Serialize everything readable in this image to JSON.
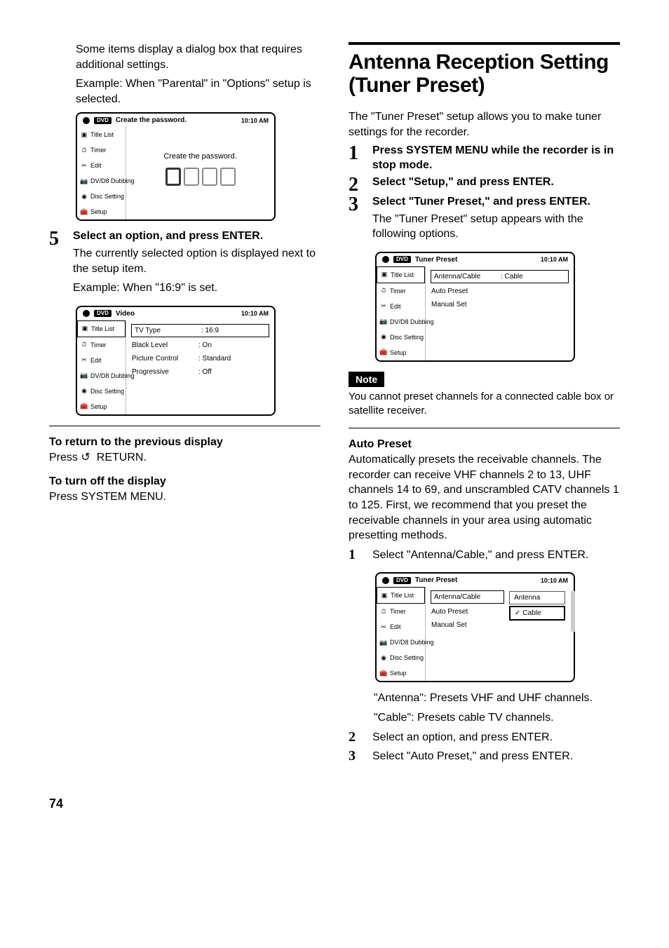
{
  "left": {
    "intro1": "Some items display a dialog box that requires additional settings.",
    "intro2": "Example: When \"Parental\" in \"Options\" setup is selected.",
    "screenshot1": {
      "badge": "DVD",
      "title": "Create the password.",
      "time": "10:10 AM",
      "sidebar": [
        "Title List",
        "Timer",
        "Edit",
        "DV/D8 Dubbing",
        "Disc Setting",
        "Setup"
      ],
      "prompt": "Create the password."
    },
    "step5": {
      "num": "5",
      "title": "Select an option, and press ENTER.",
      "desc1": "The currently selected option is displayed next to the setup item.",
      "desc2": "Example: When \"16:9\" is set."
    },
    "screenshot2": {
      "badge": "DVD",
      "title": "Video",
      "time": "10:10 AM",
      "sidebar": [
        "Title List",
        "Timer",
        "Edit",
        "DV/D8 Dubbing",
        "Disc Setting",
        "Setup"
      ],
      "rows": [
        {
          "label": "TV Type",
          "value": ": 16:9"
        },
        {
          "label": "Black Level",
          "value": ": On"
        },
        {
          "label": "Picture Control",
          "value": ": Standard"
        },
        {
          "label": "Progressive",
          "value": ": Off"
        }
      ]
    },
    "returnHeading": "To return to the previous display",
    "returnText": "Press ",
    "returnText2": " RETURN.",
    "offHeading": "To turn off the display",
    "offText": "Press SYSTEM MENU."
  },
  "right": {
    "heading": "Antenna Reception Setting (Tuner Preset)",
    "intro": "The \"Tuner Preset\" setup allows you to make tuner settings for the recorder.",
    "step1": {
      "num": "1",
      "title": "Press SYSTEM MENU while the recorder is in stop mode."
    },
    "step2": {
      "num": "2",
      "title": "Select \"Setup,\" and press ENTER."
    },
    "step3": {
      "num": "3",
      "title": "Select \"Tuner Preset,\" and press ENTER.",
      "desc": "The \"Tuner Preset\" setup appears with the following options."
    },
    "screenshot3": {
      "badge": "DVD",
      "title": "Tuner Preset",
      "time": "10:10 AM",
      "sidebar": [
        "Title List",
        "Timer",
        "Edit",
        "DV/D8 Dubbing",
        "Disc Setting",
        "Setup"
      ],
      "rows": [
        {
          "label": "Antenna/Cable",
          "value": ": Cable"
        },
        {
          "label": "Auto Preset",
          "value": ""
        },
        {
          "label": "Manual Set",
          "value": ""
        }
      ]
    },
    "noteLabel": "Note",
    "noteText": "You cannot preset channels for a connected cable box or satellite receiver.",
    "autoHeading": "Auto Preset",
    "autoText": "Automatically presets the receivable channels. The recorder can receive VHF channels 2 to 13, UHF channels 14 to 69, and unscrambled CATV channels 1 to 125. First, we recommend that you preset the receivable channels in your area using automatic presetting methods.",
    "autoStep1": {
      "num": "1",
      "text": "Select \"Antenna/Cable,\" and press ENTER."
    },
    "screenshot4": {
      "badge": "DVD",
      "title": "Tuner Preset",
      "time": "10:10 AM",
      "sidebar": [
        "Title List",
        "Timer",
        "Edit",
        "DV/D8 Dubbing",
        "Disc Setting",
        "Setup"
      ],
      "rows": [
        {
          "label": "Antenna/Cable"
        },
        {
          "label": "Auto Preset"
        },
        {
          "label": "Manual Set"
        }
      ],
      "options": [
        "Antenna",
        "Cable"
      ]
    },
    "autoNote1": "\"Antenna\": Presets VHF and UHF channels.",
    "autoNote2": "\"Cable\": Presets cable TV channels.",
    "autoStep2": {
      "num": "2",
      "text": "Select an option, and press ENTER."
    },
    "autoStep3": {
      "num": "3",
      "text": "Select \"Auto Preset,\" and press ENTER."
    }
  },
  "pageNum": "74"
}
